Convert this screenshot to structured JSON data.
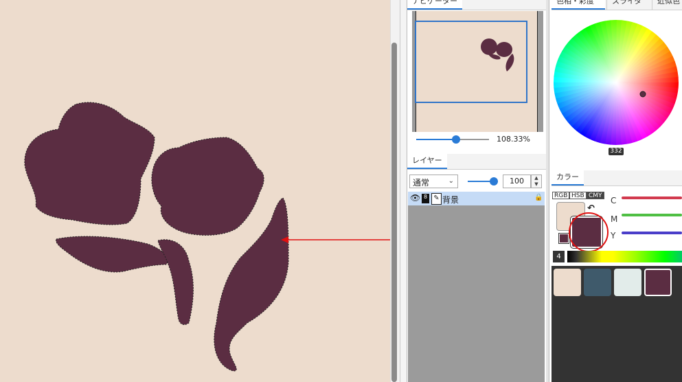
{
  "navigator": {
    "tab": "ナビゲーター",
    "zoom": "108.33%",
    "zoom_level": 0.55
  },
  "layers": {
    "tab": "レイヤー",
    "blend_mode": "通常",
    "opacity": "100",
    "opacity_level": 1.0,
    "items": [
      {
        "name": "背景",
        "bit_depth": "8"
      }
    ]
  },
  "color_wheel": {
    "tabs": [
      "色相・彩度",
      "スライダー",
      "近似色"
    ],
    "hue_value": "332"
  },
  "color_panel": {
    "tab": "カラー",
    "modes": [
      "RGB",
      "HSB",
      "CMY"
    ],
    "active_mode": "CMY",
    "channels": [
      {
        "label": "C",
        "color": "#d23a4e"
      },
      {
        "label": "M",
        "color": "#4fbf44"
      },
      {
        "label": "Y",
        "color": "#4a3ec9"
      }
    ],
    "foreground": "#5b2d42",
    "background": "#eddccd",
    "gradient_label": "4"
  },
  "palette": {
    "swatches": [
      "#eddccd",
      "#3f5a6b",
      "#e2ecea",
      "#5b2d42"
    ]
  },
  "canvas": {
    "fill": "#5b2d42",
    "paper": "#eddccd"
  },
  "annotation": {
    "color": "#e01010"
  }
}
